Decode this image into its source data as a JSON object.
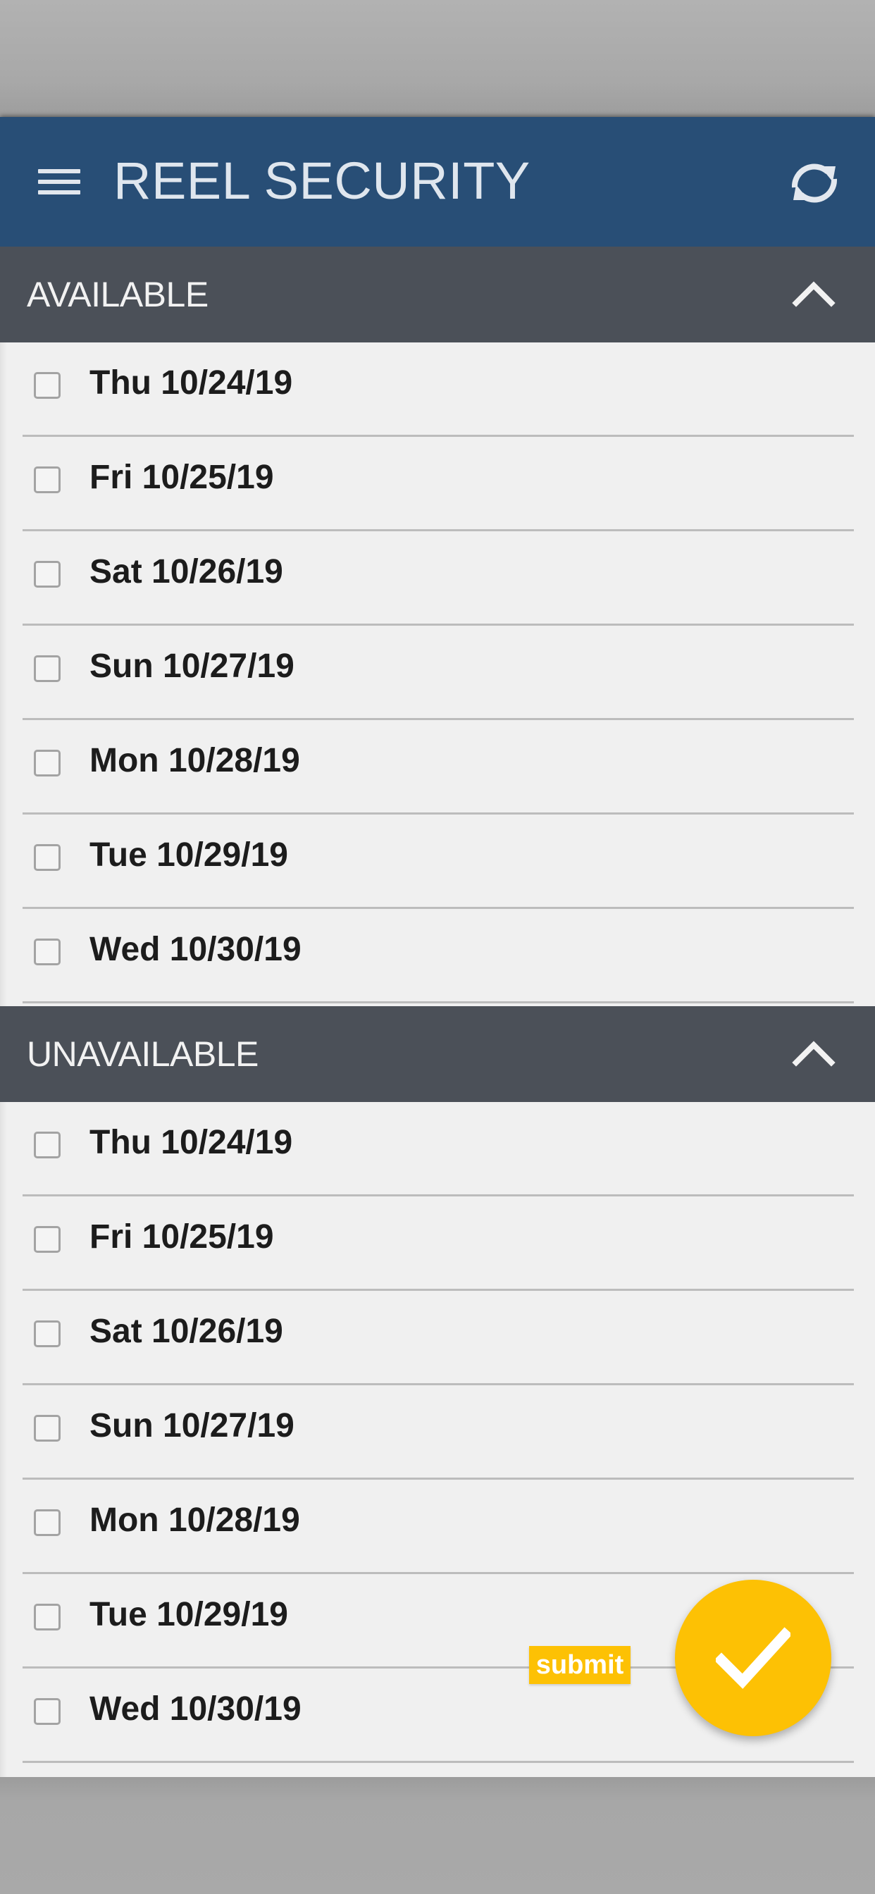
{
  "app_bar": {
    "title": "REEL SECURITY",
    "menu_icon": "hamburger-menu-icon",
    "refresh_icon": "refresh-icon",
    "background_color": "#284e76"
  },
  "sections": [
    {
      "title": "AVAILABLE",
      "expanded": true,
      "items": [
        {
          "label": "Thu 10/24/19",
          "checked": false
        },
        {
          "label": "Fri 10/25/19",
          "checked": false
        },
        {
          "label": "Sat 10/26/19",
          "checked": false
        },
        {
          "label": "Sun 10/27/19",
          "checked": false
        },
        {
          "label": "Mon 10/28/19",
          "checked": false
        },
        {
          "label": "Tue 10/29/19",
          "checked": false
        },
        {
          "label": "Wed 10/30/19",
          "checked": false
        }
      ]
    },
    {
      "title": "UNAVAILABLE",
      "expanded": true,
      "items": [
        {
          "label": "Thu 10/24/19",
          "checked": false
        },
        {
          "label": "Fri 10/25/19",
          "checked": false
        },
        {
          "label": "Sat 10/26/19",
          "checked": false
        },
        {
          "label": "Sun 10/27/19",
          "checked": false
        },
        {
          "label": "Mon 10/28/19",
          "checked": false
        },
        {
          "label": "Tue 10/29/19",
          "checked": false
        },
        {
          "label": "Wed 10/30/19",
          "checked": false
        }
      ]
    }
  ],
  "fab": {
    "icon": "checkmark-icon",
    "tooltip": "submit",
    "color": "#fdc104"
  }
}
